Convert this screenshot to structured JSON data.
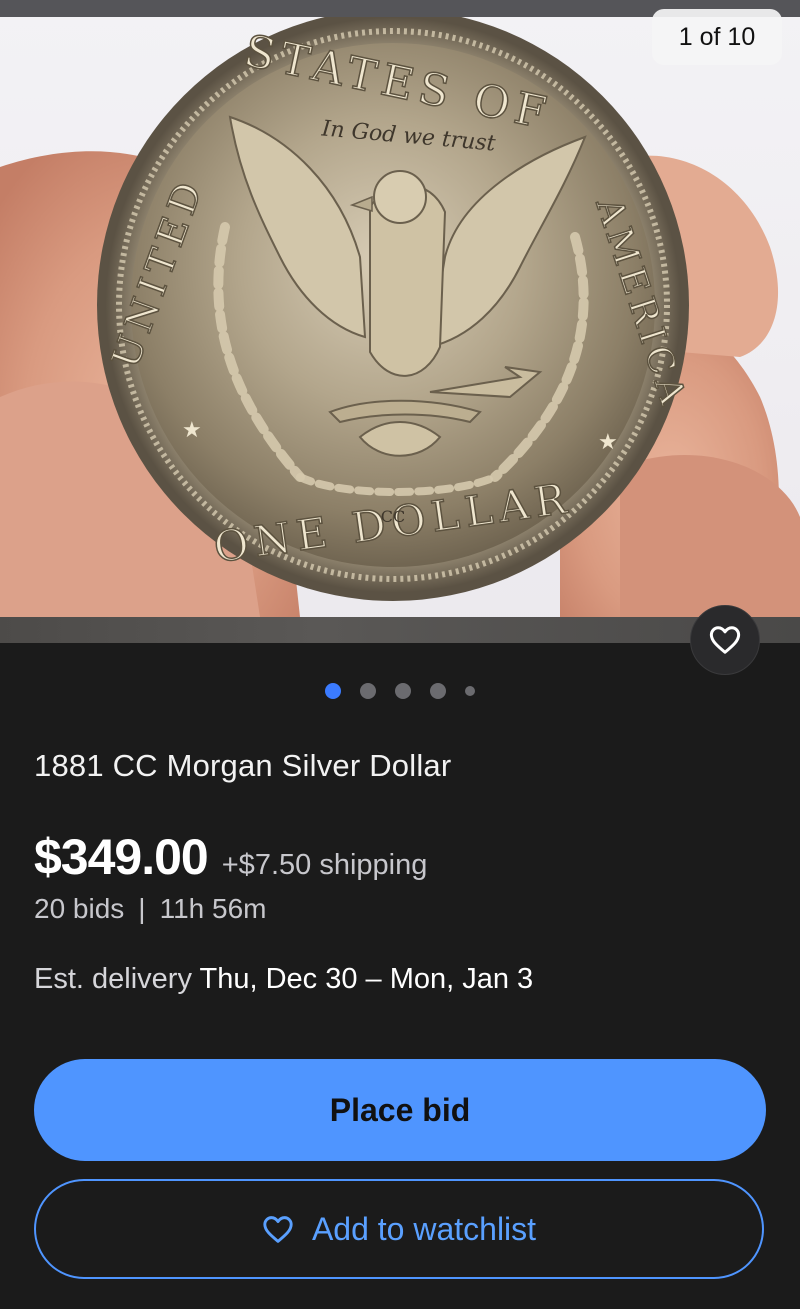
{
  "gallery": {
    "counter": "1 of 10",
    "image_alt": "Morgan silver dollar reverse held between fingers",
    "coin": {
      "top_text": "STATES OF",
      "left_text": "UNITED",
      "right_text": "AMERICA",
      "bottom_text": "ONE DOLLAR",
      "motto": "In God we trust",
      "mintmark": "CC"
    },
    "dots_count": 5,
    "active_dot": 0
  },
  "listing": {
    "title": "1881 CC Morgan Silver Dollar",
    "price": "$349.00",
    "shipping": "+$7.50 shipping",
    "bids": "20 bids",
    "separator": "|",
    "time_left": "11h 56m",
    "delivery_label": "Est. delivery",
    "delivery_dates": "Thu, Dec 30 – Mon, Jan 3"
  },
  "actions": {
    "place_bid_label": "Place bid",
    "watchlist_label": "Add to watchlist"
  },
  "colors": {
    "accent": "#4f95ff",
    "background": "#1b1b1b",
    "active_dot": "#3b7bff"
  },
  "icons": {
    "favorite": "heart-icon",
    "watchlist": "heart-outline-icon"
  }
}
